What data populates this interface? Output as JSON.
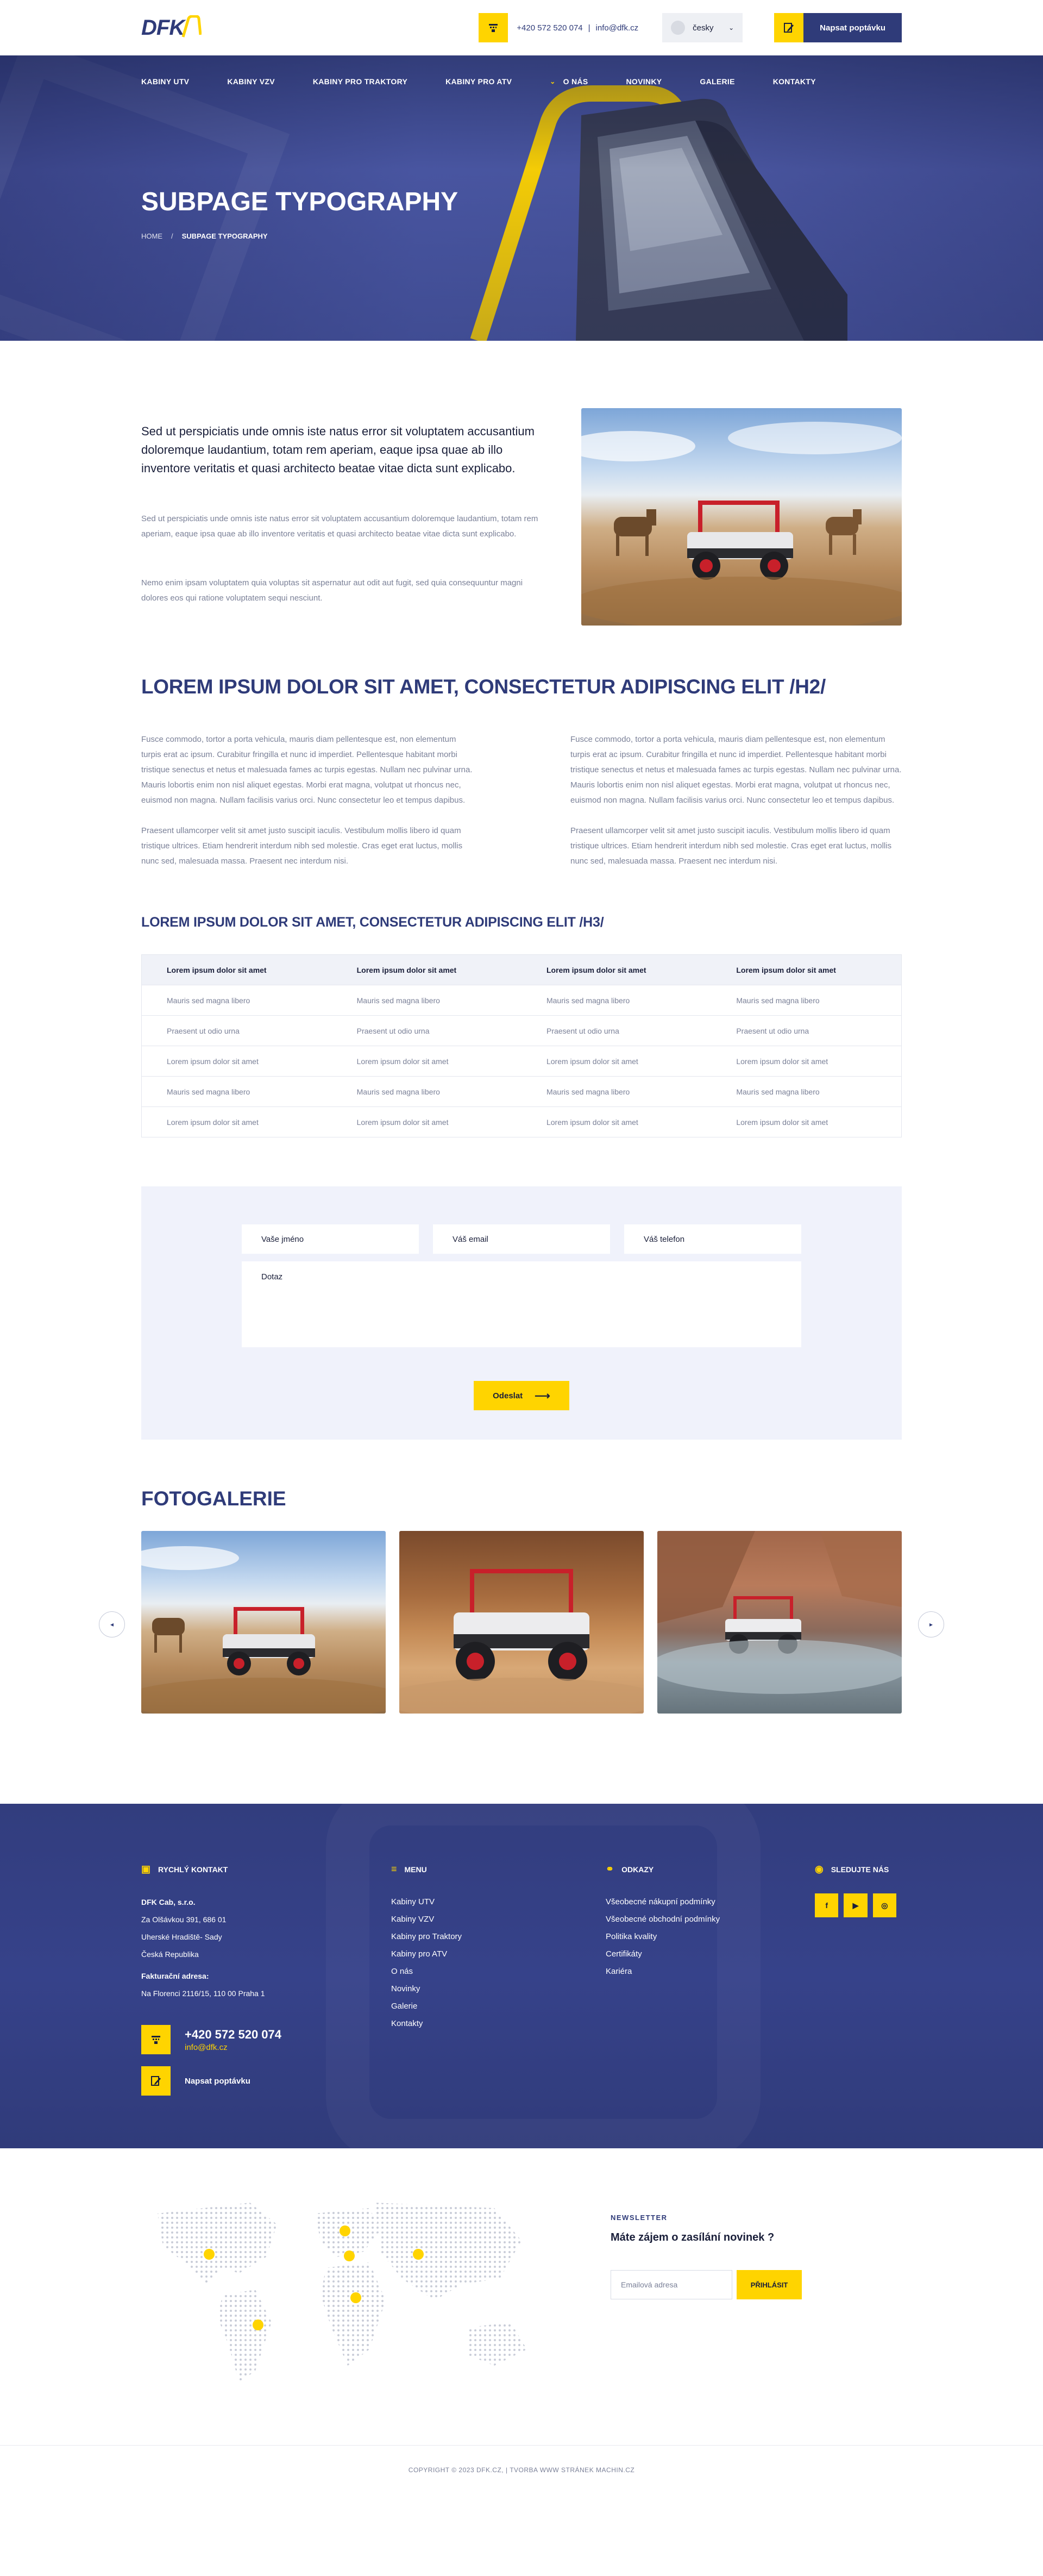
{
  "header": {
    "logo_text": "DFK",
    "phone": "+420 572 520 074",
    "separator": "|",
    "email": "info@dfk.cz",
    "language": "česky",
    "cta_label": "Napsat poptávku"
  },
  "nav": {
    "items": [
      "KABINY UTV",
      "KABINY VZV",
      "KABINY PRO TRAKTORY",
      "KABINY PRO ATV"
    ],
    "sub_item": "O NÁS",
    "items_after": [
      "NOVINKY",
      "GALERIE",
      "KONTAKTY"
    ]
  },
  "hero": {
    "title": "SUBPAGE TYPOGRAPHY",
    "breadcrumb_home": "HOME",
    "breadcrumb_sep": "/",
    "breadcrumb_current": "SUBPAGE TYPOGRAPHY"
  },
  "intro": {
    "lead": "Sed ut perspiciatis unde omnis iste natus error sit voluptatem accusantium doloremque laudantium, totam rem aperiam, eaque ipsa quae ab illo inventore veritatis et quasi architecto beatae vitae dicta sunt explicabo.",
    "body1": "Sed ut perspiciatis unde omnis iste natus error sit voluptatem accusantium doloremque laudantium, totam rem aperiam, eaque ipsa quae ab illo inventore veritatis et quasi architecto beatae vitae dicta sunt explicabo.",
    "body2": "Nemo enim ipsam voluptatem quia voluptas sit aspernatur aut odit aut fugit, sed quia consequuntur magni dolores eos qui ratione voluptatem sequi nesciunt."
  },
  "h2_section": {
    "heading": "LOREM IPSUM DOLOR SIT AMET, CONSECTETUR ADIPISCING ELIT /H2/",
    "col1_p1": "Fusce commodo, tortor a porta vehicula, mauris diam pellentesque est, non elementum turpis erat ac ipsum. Curabitur fringilla et nunc id imperdiet. Pellentesque habitant morbi tristique senectus et netus et malesuada fames ac turpis egestas. Nullam nec pulvinar urna. Mauris lobortis enim non nisl aliquet egestas. Morbi erat magna, volutpat ut rhoncus nec, euismod non magna. Nullam facilisis varius orci. Nunc consectetur leo et tempus dapibus.",
    "col1_p2": "Praesent ullamcorper velit sit amet justo suscipit iaculis. Vestibulum mollis libero id quam tristique ultrices. Etiam hendrerit interdum nibh sed molestie. Cras eget erat luctus, mollis nunc sed, malesuada massa. Praesent nec interdum nisi.",
    "col2_p1": "Fusce commodo, tortor a porta vehicula, mauris diam pellentesque est, non elementum turpis erat ac ipsum. Curabitur fringilla et nunc id imperdiet. Pellentesque habitant morbi tristique senectus et netus et malesuada fames ac turpis egestas. Nullam nec pulvinar urna. Mauris lobortis enim non nisl aliquet egestas. Morbi erat magna, volutpat ut rhoncus nec, euismod non magna. Nullam facilisis varius orci. Nunc consectetur leo et tempus dapibus.",
    "col2_p2": "Praesent ullamcorper velit sit amet justo suscipit iaculis. Vestibulum mollis libero id quam tristique ultrices. Etiam hendrerit interdum nibh sed molestie. Cras eget erat luctus, mollis nunc sed, malesuada massa. Praesent nec interdum nisi."
  },
  "h3_section": {
    "heading": "LOREM IPSUM DOLOR SIT AMET, CONSECTETUR ADIPISCING ELIT /H3/",
    "table": {
      "headers": [
        "Lorem ipsum dolor sit amet",
        "Lorem ipsum dolor sit amet",
        "Lorem ipsum dolor sit amet",
        "Lorem ipsum dolor sit amet"
      ],
      "rows": [
        [
          "Mauris sed magna libero",
          "Mauris sed magna libero",
          "Mauris sed magna libero",
          "Mauris sed magna libero"
        ],
        [
          "Praesent ut odio urna",
          "Praesent ut odio urna",
          "Praesent ut odio urna",
          "Praesent ut odio urna"
        ],
        [
          "Lorem ipsum dolor sit amet",
          "Lorem ipsum dolor sit amet",
          "Lorem ipsum dolor sit amet",
          "Lorem ipsum dolor sit amet"
        ],
        [
          "Mauris sed magna libero",
          "Mauris sed magna libero",
          "Mauris sed magna libero",
          "Mauris sed magna libero"
        ],
        [
          "Lorem ipsum dolor sit amet",
          "Lorem ipsum dolor sit amet",
          "Lorem ipsum dolor sit amet",
          "Lorem ipsum dolor sit amet"
        ]
      ]
    }
  },
  "form": {
    "name_placeholder": "Vaše jméno",
    "email_placeholder": "Váš email",
    "phone_placeholder": "Váš telefon",
    "message_placeholder": "Dotaz",
    "submit_label": "Odeslat",
    "submit_arrow": "⟶"
  },
  "gallery": {
    "title": "FOTOGALERIE",
    "prev": "◂",
    "next": "▸"
  },
  "footer": {
    "contact": {
      "heading": "RYCHLÝ KONTAKT",
      "company": "DFK Cab, s.r.o.",
      "address1": "Za Olšávkou 391, 686 01",
      "address2": "Uherské Hradiště- Sady",
      "country": "Česká Republika",
      "billing_label": "Fakturační adresa:",
      "billing_address": "Na Florenci 2116/15, 110 00 Praha 1",
      "phone": "+420 572 520 074",
      "email": "info@dfk.cz",
      "cta": "Napsat poptávku"
    },
    "menu": {
      "heading": "MENU",
      "items": [
        "Kabiny UTV",
        "Kabiny VZV",
        "Kabiny pro Traktory",
        "Kabiny pro ATV",
        "O nás",
        "Novinky",
        "Galerie",
        "Kontakty"
      ]
    },
    "links": {
      "heading": "ODKAZY",
      "items": [
        "Všeobecné nákupní podmínky",
        "Všeobecné obchodní podmínky",
        "Politika kvality",
        "Certifikáty",
        "Kariéra"
      ]
    },
    "social": {
      "heading": "SLEDUJTE NÁS",
      "icons": [
        "facebook-icon",
        "youtube-icon",
        "instagram-icon"
      ]
    }
  },
  "newsletter": {
    "kicker": "NEWSLETTER",
    "question": "Máte zájem o zasílání novinek ?",
    "input_placeholder": "Emailová adresa",
    "button": "PŘIHLÁSIT"
  },
  "copyright": "COPYRIGHT © 2023 DFK.CZ, | TVORBA WWW STRÁNEK MACHIN.CZ",
  "colors": {
    "primary": "#2f3b79",
    "accent": "#ffd400",
    "light_bg": "#f0f2fb",
    "muted_text": "#7b8198"
  }
}
